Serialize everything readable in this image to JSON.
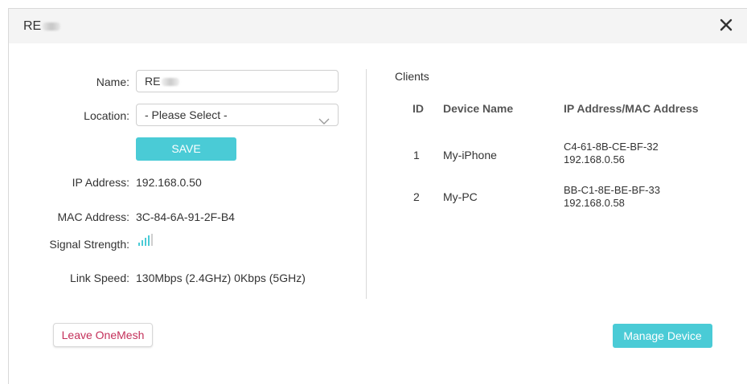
{
  "dialog": {
    "title": "RE",
    "close_icon": "close-icon"
  },
  "form": {
    "name_label": "Name:",
    "name_value": "RE",
    "location_label": "Location:",
    "location_selected": "- Please Select -",
    "save_label": "SAVE",
    "ip_label": "IP Address:",
    "ip_value": "192.168.0.50",
    "mac_label": "MAC Address:",
    "mac_value": "3C-84-6A-91-2F-B4",
    "signal_label": "Signal Strength:",
    "signal_icon": "signal-strength-icon",
    "link_label": "Link Speed:",
    "link_value": "130Mbps (2.4GHz) 0Kbps (5GHz)"
  },
  "clients": {
    "title": "Clients",
    "headers": {
      "id": "ID",
      "name": "Device Name",
      "addr": "IP Address/MAC Address"
    },
    "rows": [
      {
        "id": "1",
        "name": "My-iPhone",
        "mac": "C4-61-8B-CE-BF-32",
        "ip": "192.168.0.56"
      },
      {
        "id": "2",
        "name": "My-PC",
        "mac": "BB-C1-8E-BE-BF-33",
        "ip": "192.168.0.58"
      }
    ]
  },
  "footer": {
    "leave_label": "Leave OneMesh",
    "manage_label": "Manage Device"
  },
  "colors": {
    "accent": "#4acbd6",
    "danger_text": "#c4305a",
    "header_bg": "#f4f4f4"
  }
}
